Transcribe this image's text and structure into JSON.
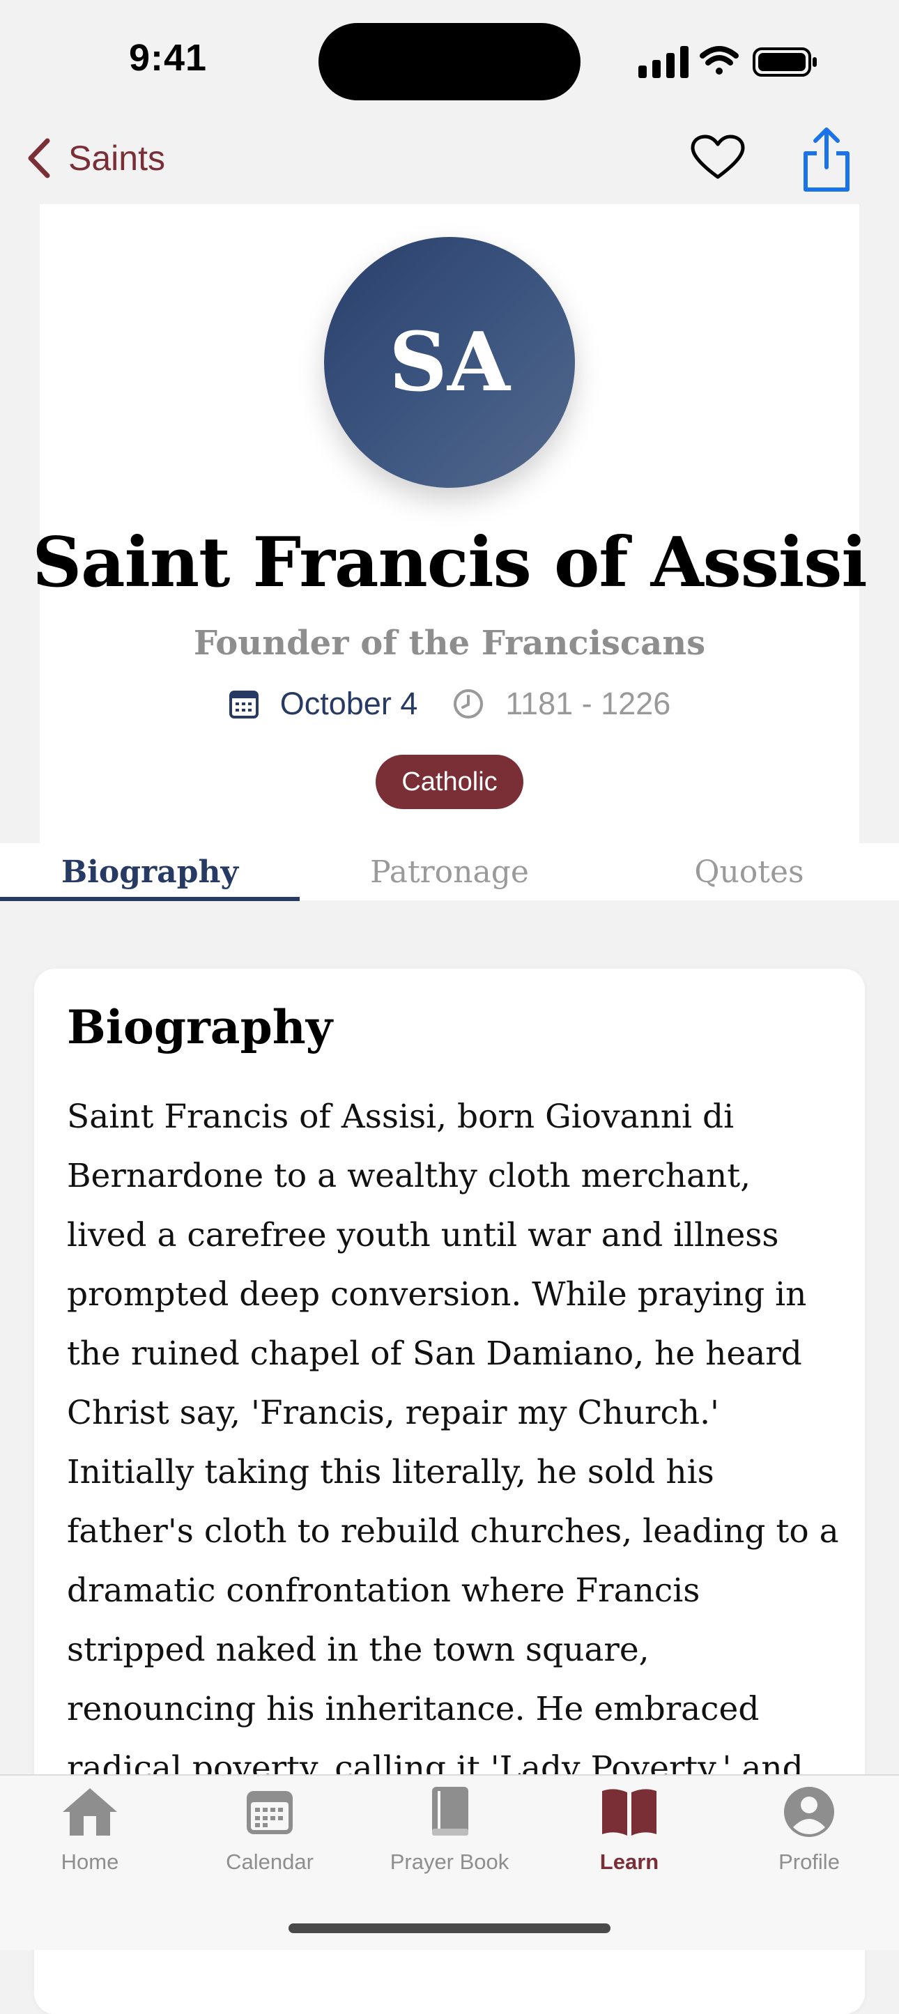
{
  "status_bar": {
    "time": "9:41"
  },
  "nav": {
    "back_label": "Saints"
  },
  "saint": {
    "initials": "SA",
    "name": "Saint Francis of Assisi",
    "subtitle": "Founder of the Franciscans",
    "feast_date": "October 4",
    "years": "1181 - 1226",
    "tradition_badge": "Catholic"
  },
  "tabs": [
    {
      "label": "Biography",
      "active": true
    },
    {
      "label": "Patronage",
      "active": false
    },
    {
      "label": "Quotes",
      "active": false
    }
  ],
  "biography": {
    "heading": "Biography",
    "text": "Saint Francis of Assisi, born Giovanni di Bernardone to a wealthy cloth merchant, lived a carefree youth until war and illness prompted deep conversion. While praying in the ruined chapel of San Damiano, he heard Christ say, 'Francis, repair my Church.' Initially taking this literally, he sold his father's cloth to rebuild churches, leading to a dramatic confrontation where Francis stripped naked in the town square, renouncing his inheritance. He embraced radical poverty, calling it 'Lady Poverty,' and began preaching penance."
  },
  "tab_bar": [
    {
      "label": "Home",
      "icon": "house-icon",
      "active": false
    },
    {
      "label": "Calendar",
      "icon": "calendar-icon",
      "active": false
    },
    {
      "label": "Prayer Book",
      "icon": "book-icon",
      "active": false
    },
    {
      "label": "Learn",
      "icon": "open-book-icon",
      "active": true
    },
    {
      "label": "Profile",
      "icon": "person-circle-icon",
      "active": false
    }
  ],
  "colors": {
    "accent_burgundy": "#7a2e35",
    "accent_navy": "#263a63",
    "share_blue": "#1a73e8"
  }
}
